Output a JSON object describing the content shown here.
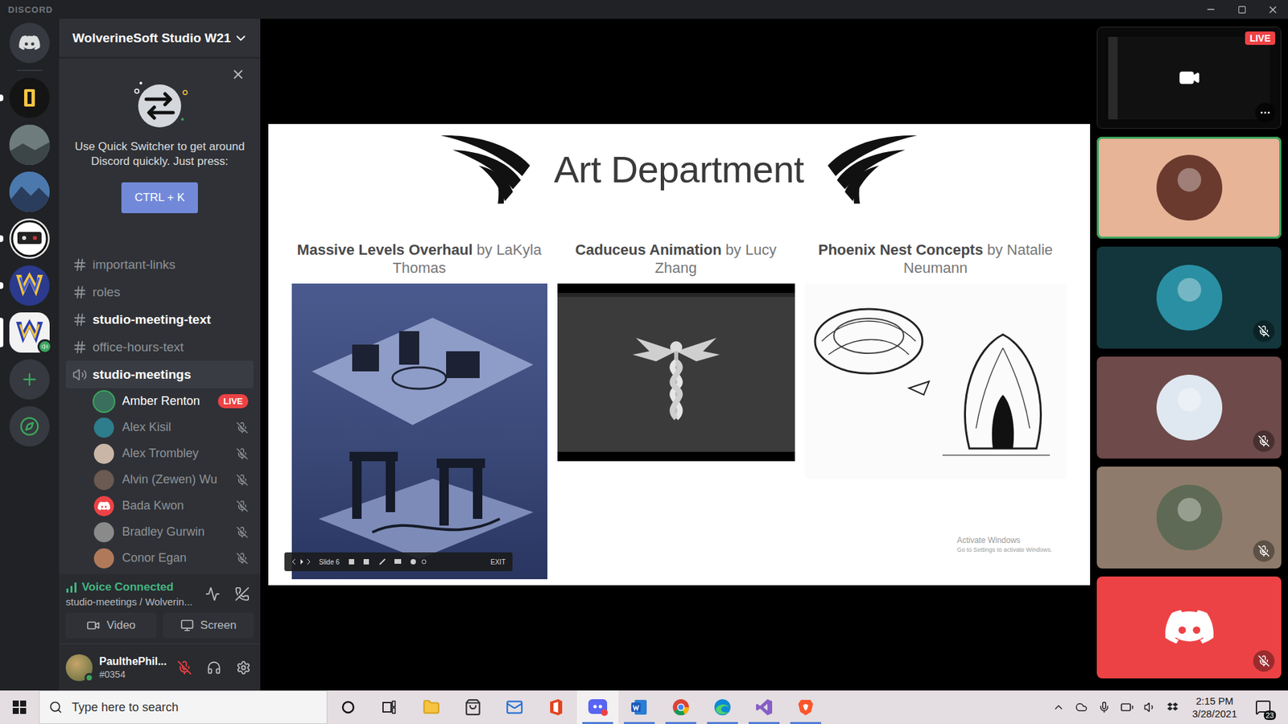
{
  "window": {
    "title": "DISCORD"
  },
  "servers": [
    {
      "kind": "home",
      "selected": false,
      "unread": false,
      "voice": false,
      "color": "#36393f"
    },
    {
      "kind": "server",
      "selected": false,
      "unread": true,
      "voice": false,
      "color": "#141414"
    },
    {
      "kind": "server",
      "selected": false,
      "unread": false,
      "voice": false,
      "color": "#5d6b6e"
    },
    {
      "kind": "server",
      "selected": false,
      "unread": false,
      "voice": false,
      "color": "#3c5f8c"
    },
    {
      "kind": "server",
      "selected": false,
      "unread": true,
      "voice": false,
      "color": "#e8e8e8"
    },
    {
      "kind": "server",
      "selected": false,
      "unread": true,
      "voice": false,
      "color": "#2b3a8c"
    },
    {
      "kind": "server",
      "selected": true,
      "unread": false,
      "voice": true,
      "color": "#f2f2f2"
    },
    {
      "kind": "add",
      "selected": false,
      "unread": false,
      "voice": false,
      "color": "#36393f"
    },
    {
      "kind": "explore",
      "selected": false,
      "unread": false,
      "voice": false,
      "color": "#36393f"
    }
  ],
  "server_header": {
    "name": "WolverineSoft Studio W21"
  },
  "quick_switcher": {
    "text": "Use Quick Switcher to get around Discord quickly. Just press:",
    "shortcut": "CTRL + K"
  },
  "channels": [
    {
      "name": "important-links",
      "kind": "text",
      "unread": false,
      "selected": false
    },
    {
      "name": "roles",
      "kind": "text",
      "unread": false,
      "selected": false
    },
    {
      "name": "studio-meeting-text",
      "kind": "text",
      "unread": true,
      "selected": false
    },
    {
      "name": "office-hours-text",
      "kind": "text",
      "unread": false,
      "selected": false
    },
    {
      "name": "studio-meetings",
      "kind": "voice",
      "unread": true,
      "selected": true
    }
  ],
  "voice_members": {
    "live_label": "LIVE",
    "members": [
      {
        "name": "Amber Renton",
        "kind": "photo",
        "color": "#3a6f5e",
        "live": true,
        "speaking": true,
        "muted": false
      },
      {
        "name": "Alex Kisil",
        "kind": "photo",
        "color": "#2e7d8c",
        "live": false,
        "speaking": false,
        "muted": true
      },
      {
        "name": "Alex Trombley",
        "kind": "photo",
        "color": "#c9b6a6",
        "live": false,
        "speaking": false,
        "muted": true
      },
      {
        "name": "Alvin (Zewen) Wu",
        "kind": "photo",
        "color": "#6b5a52",
        "live": false,
        "speaking": false,
        "muted": true
      },
      {
        "name": "Bada Kwon",
        "kind": "default",
        "color": "#ed4245",
        "live": false,
        "speaking": false,
        "muted": true
      },
      {
        "name": "Bradley Gurwin",
        "kind": "photo",
        "color": "#8a8a8a",
        "live": false,
        "speaking": false,
        "muted": true
      },
      {
        "name": "Conor Egan",
        "kind": "photo",
        "color": "#b07a5a",
        "live": false,
        "speaking": false,
        "muted": true
      }
    ]
  },
  "voice_panel": {
    "status": "Voice Connected",
    "location": "studio-meetings / Wolverin...",
    "buttons": [
      "Video",
      "Screen"
    ]
  },
  "user": {
    "name": "PaulthePhil...",
    "tag": "#0354",
    "mic_muted": true
  },
  "slide": {
    "title": "Art Department",
    "items": [
      {
        "title": "Massive Levels Overhaul",
        "byline": "by LaKyla Thomas",
        "kind": "render"
      },
      {
        "title": "Caduceus Animation",
        "byline": "by Lucy Zhang",
        "kind": "animation"
      },
      {
        "title": "Phoenix Nest Concepts",
        "byline": "by Natalie Neumann",
        "kind": "sketch"
      }
    ],
    "toolbar": {
      "slide": "Slide 6",
      "exit": "EXIT"
    },
    "watermark": {
      "title": "Activate Windows",
      "subtitle": "Go to Settings to activate Windows."
    }
  },
  "stream_preview": {
    "badge": "LIVE"
  },
  "tiles": [
    {
      "kind": "avatar",
      "color": "#e7b497",
      "avatar_color": "#6b3a2e",
      "speaking": true,
      "muted": false
    },
    {
      "kind": "avatar",
      "color": "#12363b",
      "avatar_color": "#2a8fa3",
      "speaking": false,
      "muted": true
    },
    {
      "kind": "avatar",
      "color": "#6e4a4a",
      "avatar_color": "#dfe8f0",
      "speaking": false,
      "muted": true
    },
    {
      "kind": "avatar",
      "color": "#8f7b6b",
      "avatar_color": "#5e6a55",
      "speaking": false,
      "muted": true
    },
    {
      "kind": "discord",
      "color": "#ed4245",
      "avatar_color": "#ed4245",
      "speaking": false,
      "muted": true
    }
  ],
  "taskbar": {
    "search_placeholder": "Type here to search",
    "apps": [
      {
        "kind": "cortana",
        "running": false,
        "selected": false
      },
      {
        "kind": "taskview",
        "running": false,
        "selected": false
      },
      {
        "kind": "explorer",
        "running": false,
        "selected": false
      },
      {
        "kind": "store",
        "running": false,
        "selected": false
      },
      {
        "kind": "mail",
        "running": false,
        "selected": false
      },
      {
        "kind": "office",
        "running": false,
        "selected": false
      },
      {
        "kind": "discord",
        "running": true,
        "selected": true
      },
      {
        "kind": "word",
        "running": true,
        "selected": false
      },
      {
        "kind": "chrome",
        "running": true,
        "selected": false
      },
      {
        "kind": "edge",
        "running": true,
        "selected": false
      },
      {
        "kind": "vs",
        "running": true,
        "selected": false
      },
      {
        "kind": "brave",
        "running": true,
        "selected": false
      }
    ],
    "time": "2:15 PM",
    "date": "3/28/2021",
    "notifications": "23"
  }
}
